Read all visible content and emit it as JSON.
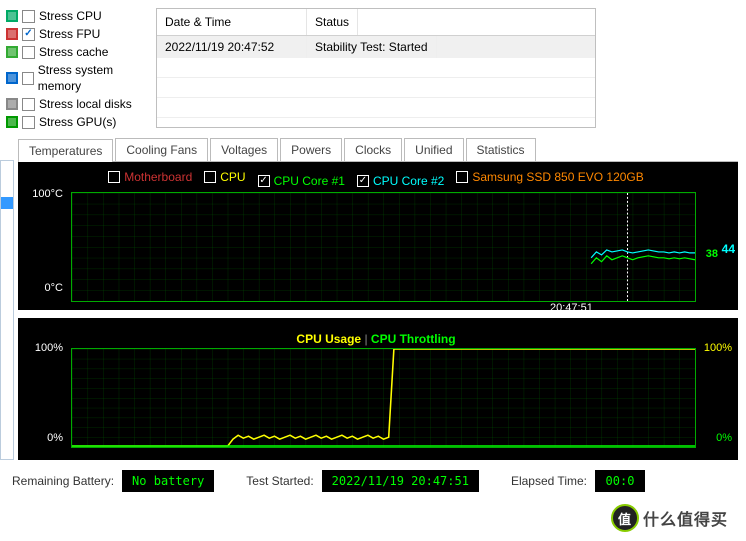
{
  "stress_options": [
    {
      "label": "Stress CPU",
      "checked": false,
      "icon": "#0a6"
    },
    {
      "label": "Stress FPU",
      "checked": true,
      "icon": "#c33"
    },
    {
      "label": "Stress cache",
      "checked": false,
      "icon": "#3a3"
    },
    {
      "label": "Stress system memory",
      "checked": false,
      "icon": "#06c"
    },
    {
      "label": "Stress local disks",
      "checked": false,
      "icon": "#888"
    },
    {
      "label": "Stress GPU(s)",
      "checked": false,
      "icon": "#090"
    }
  ],
  "event_table": {
    "headers": {
      "datetime": "Date & Time",
      "status": "Status"
    },
    "rows": [
      {
        "datetime": "2022/11/19 20:47:52",
        "status": "Stability Test: Started"
      }
    ]
  },
  "tabs": [
    "Temperatures",
    "Cooling Fans",
    "Voltages",
    "Powers",
    "Clocks",
    "Unified",
    "Statistics"
  ],
  "active_tab": 0,
  "temp_chart": {
    "legend": [
      {
        "label": "Motherboard",
        "checked": false,
        "color": "#c33"
      },
      {
        "label": "CPU",
        "checked": false,
        "color": "#ff0"
      },
      {
        "label": "CPU Core #1",
        "checked": true,
        "color": "#0f0"
      },
      {
        "label": "CPU Core #2",
        "checked": true,
        "color": "#0ff"
      },
      {
        "label": "Samsung SSD 850 EVO 120GB",
        "checked": false,
        "color": "#f80"
      }
    ],
    "y_top": "100°C",
    "y_bot": "0°C",
    "x_marker": "20:47:51",
    "readouts": {
      "core1": "38",
      "core2": "44"
    }
  },
  "usage_chart": {
    "title_left": "CPU Usage",
    "title_right": "CPU Throttling",
    "y_left_top": "100%",
    "y_left_bot": "0%",
    "y_right_top": "100%",
    "y_right_bot": "0%"
  },
  "status": {
    "battery_label": "Remaining Battery:",
    "battery_value": "No battery",
    "started_label": "Test Started:",
    "started_value": "2022/11/19 20:47:51",
    "elapsed_label": "Elapsed Time:",
    "elapsed_value": "00:0"
  },
  "watermark": "什么值得买",
  "watermark_badge": "值",
  "chart_data": [
    {
      "type": "line",
      "title": "Temperatures",
      "ylabel": "°C",
      "ylim": [
        0,
        100
      ],
      "x_marker": "20:47:51",
      "series": [
        {
          "name": "CPU Core #1",
          "color": "#00ff00",
          "values": [
            36,
            40,
            37,
            41,
            38,
            39,
            40,
            38,
            37,
            38,
            39,
            40,
            39,
            38,
            38
          ]
        },
        {
          "name": "CPU Core #2",
          "color": "#00ffff",
          "values": [
            39,
            43,
            41,
            45,
            44,
            43,
            45,
            44,
            42,
            43,
            44,
            45,
            44,
            44,
            44
          ]
        }
      ],
      "current": {
        "CPU Core #1": 38,
        "CPU Core #2": 44
      }
    },
    {
      "type": "line",
      "title": "CPU Usage / CPU Throttling",
      "ylim": [
        0,
        100
      ],
      "series": [
        {
          "name": "CPU Usage",
          "color": "#ffff00",
          "values": [
            0,
            0,
            0,
            0,
            0,
            0,
            0,
            0,
            0,
            0,
            0,
            0,
            0,
            0,
            0,
            0,
            0,
            0,
            0,
            0,
            7,
            12,
            9,
            11,
            8,
            10,
            9,
            11,
            8,
            12,
            10,
            9,
            11,
            8,
            10,
            9,
            11,
            100,
            100,
            100,
            100,
            100,
            100,
            100,
            100,
            100,
            100,
            100,
            100,
            100,
            100,
            100,
            100,
            100,
            100,
            100,
            100,
            100,
            100,
            100,
            100,
            100
          ]
        },
        {
          "name": "CPU Throttling",
          "color": "#00ff00",
          "values": [
            0,
            0,
            0,
            0,
            0,
            0,
            0,
            0,
            0,
            0,
            0,
            0,
            0,
            0,
            0,
            0,
            0,
            0,
            0,
            0,
            0,
            0,
            0,
            0,
            0,
            0,
            0,
            0,
            0,
            0,
            0,
            0,
            0,
            0,
            0,
            0,
            0,
            0,
            0,
            0,
            0,
            0,
            0,
            0,
            0,
            0,
            0,
            0,
            0,
            0,
            0,
            0,
            0,
            0,
            0,
            0,
            0,
            0,
            0,
            0,
            0,
            0
          ]
        }
      ],
      "current": {
        "CPU Usage": 100,
        "CPU Throttling": 0
      }
    }
  ]
}
